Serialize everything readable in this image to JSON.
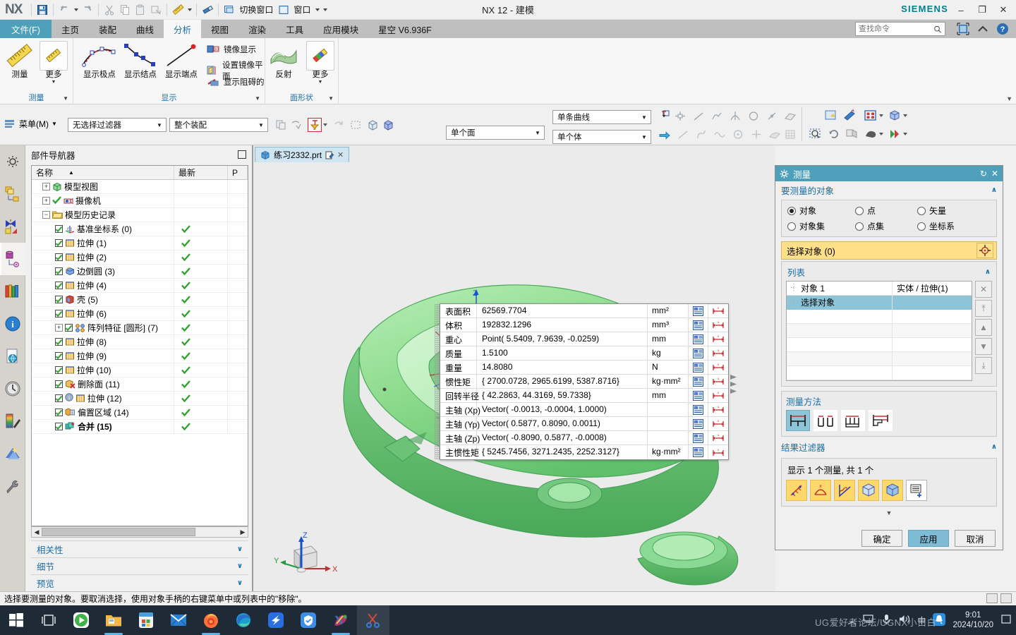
{
  "window": {
    "title": "NX 12 - 建模",
    "brand": "SIEMENS",
    "logo": "NX",
    "minimize": "–",
    "maximize": "❐",
    "close": "✕"
  },
  "quickbar": {
    "items": [
      {
        "name": "save-icon",
        "label": ""
      },
      {
        "name": "undo-icon",
        "label": ""
      },
      {
        "name": "redo-icon",
        "label": ""
      },
      {
        "name": "cut-icon",
        "label": ""
      },
      {
        "name": "copy-icon",
        "label": ""
      },
      {
        "name": "paste-icon",
        "label": ""
      },
      {
        "name": "paste-special-icon",
        "label": ""
      },
      {
        "name": "measure-icon",
        "label": ""
      },
      {
        "name": "eraser-icon",
        "label": ""
      }
    ],
    "switch_window": "切换窗口",
    "window_menu": "窗口"
  },
  "search": {
    "placeholder": "查找命令"
  },
  "tabs": {
    "file": "文件(F)",
    "items": [
      {
        "label": "主页",
        "active": false
      },
      {
        "label": "装配",
        "active": false
      },
      {
        "label": "曲线",
        "active": false
      },
      {
        "label": "分析",
        "active": true
      },
      {
        "label": "视图",
        "active": false
      },
      {
        "label": "渲染",
        "active": false
      },
      {
        "label": "工具",
        "active": false
      },
      {
        "label": "应用模块",
        "active": false
      },
      {
        "label": "星空 V6.936F",
        "active": false
      }
    ]
  },
  "ribbon": {
    "groups": [
      {
        "label": "测量"
      },
      {
        "label": "显示"
      },
      {
        "label": "面形状"
      }
    ],
    "measure_group": {
      "measure": "测量",
      "more": "更多"
    },
    "display_group": {
      "show_poles": "显示极点",
      "show_knots": "显示结点",
      "show_endpoints": "显示端点",
      "mirror_display": "镜像显示",
      "set_mirror_plane": "设置镜像平面...",
      "show_obstructed": "显示阻碍的"
    },
    "face_group": {
      "reflection": "反射",
      "more": "更多"
    }
  },
  "selbar": {
    "menu": "菜单(M)",
    "filter_combo": "无选择过滤器",
    "scope_combo": "整个装配",
    "face_combo": "单个面",
    "curve_combo": "单条曲线",
    "body_combo": "单个体"
  },
  "resource_bar": {
    "items": [
      {
        "name": "assembly-navigator-icon"
      },
      {
        "name": "constraint-navigator-icon"
      },
      {
        "name": "part-navigator-icon",
        "active": true
      },
      {
        "name": "reuse-library-icon"
      },
      {
        "name": "hd3d-icon"
      },
      {
        "name": "web-browser-icon"
      },
      {
        "name": "history-icon"
      },
      {
        "name": "system-materials-icon"
      },
      {
        "name": "system-scenes-icon"
      },
      {
        "name": "customer-defaults-icon"
      }
    ]
  },
  "navigator": {
    "title": "部件导航器",
    "columns": [
      "名称",
      "最新",
      "P"
    ],
    "rows": [
      {
        "label": "模型视图",
        "indent": 0,
        "expander": "+",
        "check": false,
        "updated": false,
        "icon": "model-views-icon",
        "bold": false
      },
      {
        "label": "摄像机",
        "indent": 0,
        "expander": "+",
        "check": false,
        "updated": false,
        "icon": "cameras-icon",
        "bold": false,
        "lead_tick": true
      },
      {
        "label": "模型历史记录",
        "indent": 0,
        "expander": "−",
        "check": false,
        "updated": false,
        "icon": "folder-icon",
        "bold": false
      },
      {
        "label": "基准坐标系 (0)",
        "indent": 1,
        "expander": "",
        "check": true,
        "updated": true,
        "icon": "datum-csys-icon",
        "bold": false
      },
      {
        "label": "拉伸 (1)",
        "indent": 1,
        "expander": "",
        "check": true,
        "updated": true,
        "icon": "extrude-icon",
        "bold": false
      },
      {
        "label": "拉伸 (2)",
        "indent": 1,
        "expander": "",
        "check": true,
        "updated": true,
        "icon": "extrude-icon",
        "bold": false
      },
      {
        "label": "边倒圆 (3)",
        "indent": 1,
        "expander": "",
        "check": true,
        "updated": true,
        "icon": "edge-blend-icon",
        "bold": false
      },
      {
        "label": "拉伸 (4)",
        "indent": 1,
        "expander": "",
        "check": true,
        "updated": true,
        "icon": "extrude-icon",
        "bold": false
      },
      {
        "label": "壳 (5)",
        "indent": 1,
        "expander": "",
        "check": true,
        "updated": true,
        "icon": "shell-icon",
        "bold": false
      },
      {
        "label": "拉伸 (6)",
        "indent": 1,
        "expander": "",
        "check": true,
        "updated": true,
        "icon": "extrude-icon",
        "bold": false
      },
      {
        "label": "阵列特征 [圆形] (7)",
        "indent": 1,
        "expander": "+",
        "check": true,
        "updated": true,
        "icon": "pattern-feature-icon",
        "bold": false
      },
      {
        "label": "拉伸 (8)",
        "indent": 1,
        "expander": "",
        "check": true,
        "updated": true,
        "icon": "extrude-icon",
        "bold": false
      },
      {
        "label": "拉伸 (9)",
        "indent": 1,
        "expander": "",
        "check": true,
        "updated": true,
        "icon": "extrude-icon",
        "bold": false
      },
      {
        "label": "拉伸 (10)",
        "indent": 1,
        "expander": "",
        "check": true,
        "updated": true,
        "icon": "extrude-icon",
        "bold": false
      },
      {
        "label": "删除面 (11)",
        "indent": 1,
        "expander": "",
        "check": true,
        "updated": true,
        "icon": "delete-face-icon",
        "bold": false
      },
      {
        "label": "拉伸 (12)",
        "indent": 1,
        "expander": "",
        "check": true,
        "updated": true,
        "icon": "extrude-icon",
        "bold": false,
        "info": true
      },
      {
        "label": "偏置区域 (14)",
        "indent": 1,
        "expander": "",
        "check": true,
        "updated": true,
        "icon": "offset-region-icon",
        "bold": false
      },
      {
        "label": "合并 (15)",
        "indent": 1,
        "expander": "",
        "check": true,
        "updated": true,
        "icon": "unite-icon",
        "bold": true
      }
    ],
    "sections": [
      {
        "label": "相关性"
      },
      {
        "label": "细节"
      },
      {
        "label": "预览"
      }
    ]
  },
  "document": {
    "tab_label": "练习2332.prt",
    "modified_icon": "modified-icon",
    "close_icon": "✕"
  },
  "results_table": {
    "rows": [
      {
        "key": "表面积",
        "value": "62569.7704",
        "unit": "mm²"
      },
      {
        "key": "体积",
        "value": "192832.1296",
        "unit": "mm³"
      },
      {
        "key": "重心",
        "value": "Point( 5.5409, 7.9639, -0.0259)",
        "unit": "mm"
      },
      {
        "key": "质量",
        "value": "1.5100",
        "unit": "kg"
      },
      {
        "key": "重量",
        "value": "14.8080",
        "unit": "N"
      },
      {
        "key": "惯性矩",
        "value": "{ 2700.0728, 2965.6199, 5387.8716}",
        "unit": "kg·mm²"
      },
      {
        "key": "回转半径",
        "value": "{ 42.2863, 44.3169, 59.7338}",
        "unit": "mm"
      },
      {
        "key": "主轴 (Xp)",
        "value": "Vector( -0.0013, -0.0004, 1.0000)",
        "unit": ""
      },
      {
        "key": "主轴 (Yp)",
        "value": "Vector( 0.5877, 0.8090, 0.0011)",
        "unit": ""
      },
      {
        "key": "主轴 (Zp)",
        "value": "Vector( -0.8090, 0.5877, -0.0008)",
        "unit": ""
      },
      {
        "key": "主惯性矩",
        "value": "{ 5245.7456, 3271.2435, 2252.3127}",
        "unit": "kg·mm²"
      }
    ]
  },
  "measure_dialog": {
    "title": "测量",
    "reset_icon": "↻",
    "close_icon": "✕",
    "section_objects": "要测量的对象",
    "radios": [
      {
        "label": "对象",
        "selected": true
      },
      {
        "label": "点",
        "selected": false
      },
      {
        "label": "矢量",
        "selected": false
      },
      {
        "label": "对象集",
        "selected": false
      },
      {
        "label": "点集",
        "selected": false
      },
      {
        "label": "坐标系",
        "selected": false
      }
    ],
    "select_object": "选择对象 (0)",
    "list_title": "列表",
    "list_rows": [
      {
        "c1": "对象 1",
        "c2": "实体 / 拉伸(1)",
        "selected": false
      },
      {
        "c1": "选择对象",
        "c2": "",
        "selected": true
      },
      {
        "c1": "",
        "c2": "",
        "selected": false
      },
      {
        "c1": "",
        "c2": "",
        "selected": false
      },
      {
        "c1": "",
        "c2": "",
        "selected": false
      },
      {
        "c1": "",
        "c2": "",
        "selected": false
      },
      {
        "c1": "",
        "c2": "",
        "selected": false
      }
    ],
    "list_buttons": [
      "✕",
      "⤒",
      "▲",
      "▼",
      "⤓"
    ],
    "method_title": "测量方法",
    "method_icons": [
      "method-simple-icon",
      "method-pairs-icon",
      "method-multi-icon",
      "method-step-icon"
    ],
    "filter_title": "结果过滤器",
    "filter_text": "显示 1 个测量, 共 1 个",
    "filter_icons": [
      "dimension-icon",
      "arc-icon",
      "angle-icon",
      "solid-icon",
      "body-icon",
      "list-add-icon"
    ],
    "buttons": {
      "ok": "确定",
      "apply": "应用",
      "cancel": "取消"
    }
  },
  "triad": {
    "x": "X",
    "y": "Y",
    "z": "Z"
  },
  "model_axis": {
    "z": "Z"
  },
  "statusbar": {
    "message": "选择要测量的对象。要取消选择，使用对象手柄的右键菜单中或列表中的\"移除\"。"
  },
  "taskbar": {
    "items": [
      {
        "name": "start-icon",
        "active": false,
        "underline": false
      },
      {
        "name": "task-view-icon",
        "active": false,
        "underline": false
      },
      {
        "name": "media-player-icon",
        "active": false,
        "underline": false
      },
      {
        "name": "file-explorer-icon",
        "active": false,
        "underline": true
      },
      {
        "name": "microsoft-store-icon",
        "active": false,
        "underline": false
      },
      {
        "name": "mail-icon",
        "active": false,
        "underline": false
      },
      {
        "name": "firefox-icon",
        "active": false,
        "underline": true
      },
      {
        "name": "edge-icon",
        "active": false,
        "underline": false
      },
      {
        "name": "kuaishou-icon",
        "active": false,
        "underline": false
      },
      {
        "name": "security-icon",
        "active": false,
        "underline": false
      },
      {
        "name": "nx-icon",
        "active": false,
        "underline": true
      },
      {
        "name": "snip-tool-icon",
        "active": true,
        "underline": false
      }
    ],
    "tray": {
      "chevron": "︿",
      "network_icon": "network-icon",
      "mic_icon": "mic-icon",
      "volume_icon": "volume-icon",
      "ime": "中",
      "qq_icon": "qq-icon",
      "time": "9:01",
      "date": "2024/10/20",
      "notif_icon": "notification-icon"
    },
    "watermark": "UG爱好者论坛/UGNX小白白"
  },
  "colors": {
    "accent": "#4e9fba",
    "brand": "#00828c",
    "highlight": "#ffe08a",
    "model_green": "#8fdc8f",
    "link": "#1a6ea8"
  }
}
